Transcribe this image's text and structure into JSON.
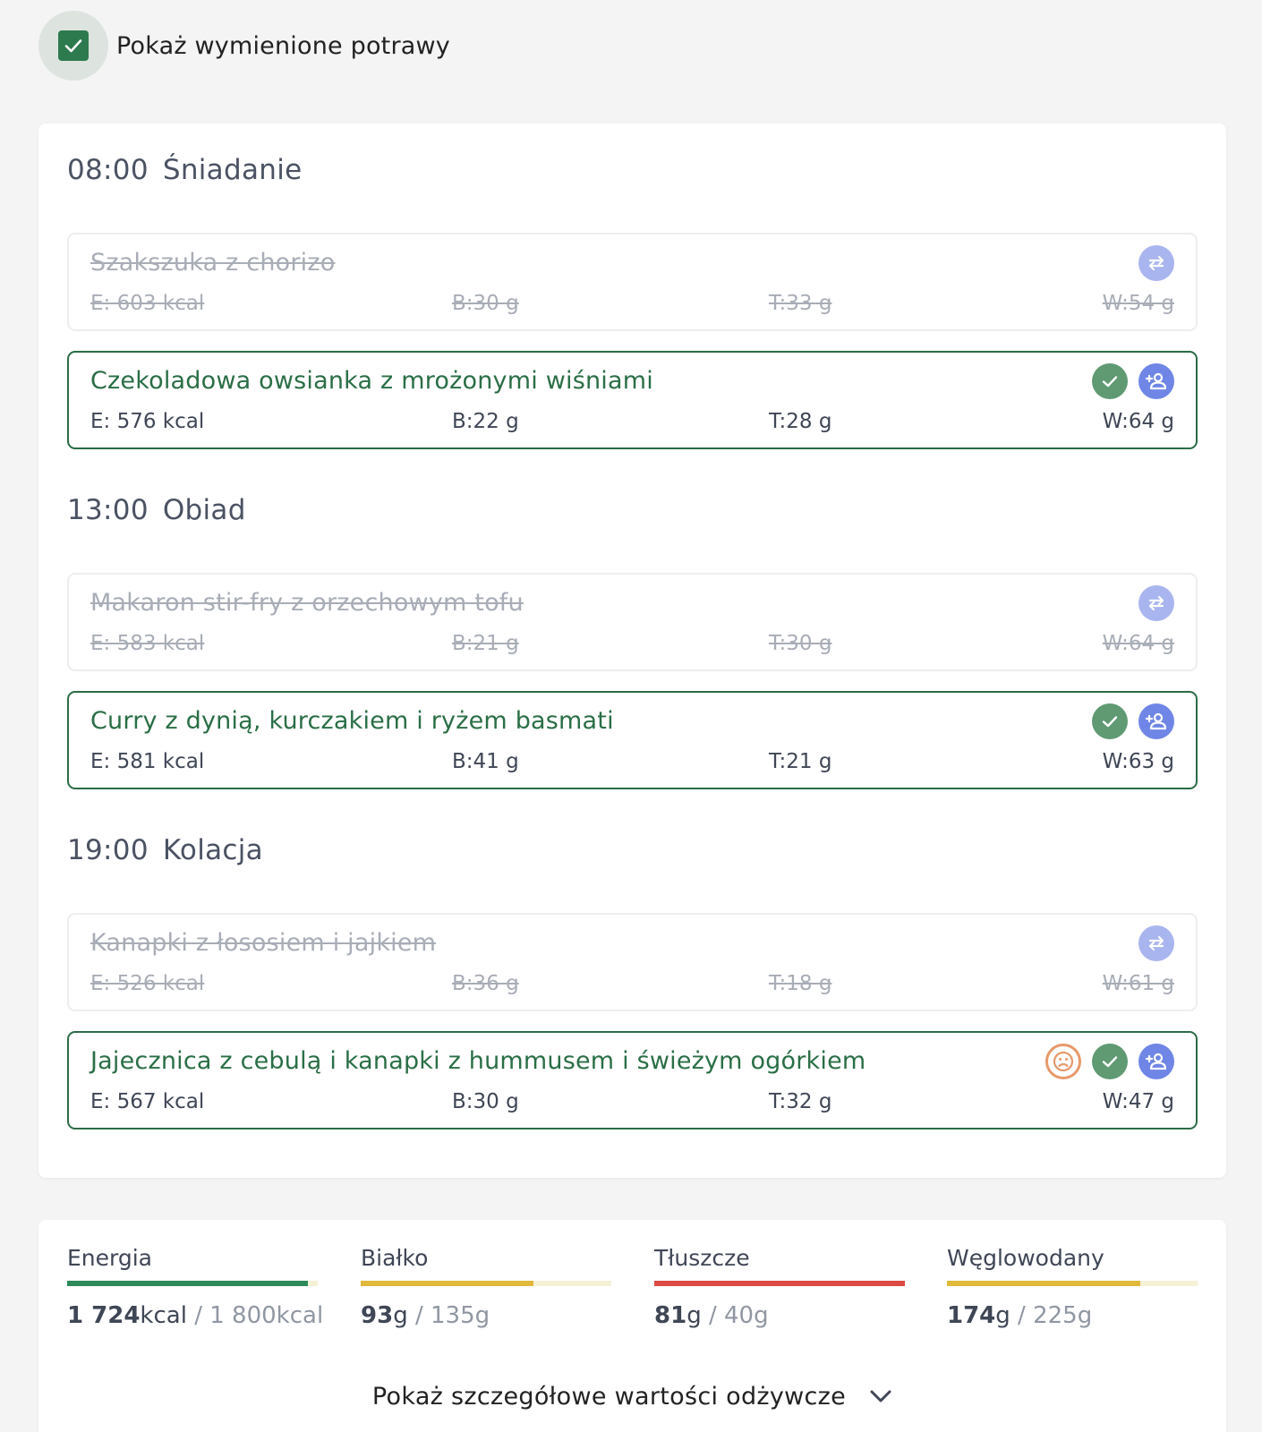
{
  "toggle": {
    "label": "Pokaż wymienione potrawy",
    "checked": true
  },
  "meals": [
    {
      "time": "08:00",
      "name": "Śniadanie",
      "replaced": {
        "name": "Szakszuka z chorizo",
        "e": "E: 603 kcal",
        "b": "B:30 g",
        "t": "T:33 g",
        "w": "W:54 g"
      },
      "current": {
        "name": "Czekoladowa owsianka z mrożonymi wiśniami",
        "e": "E: 576 kcal",
        "b": "B:22 g",
        "t": "T:28 g",
        "w": "W:64 g",
        "icons": [
          "check-icon",
          "add-person-icon"
        ]
      }
    },
    {
      "time": "13:00",
      "name": "Obiad",
      "replaced": {
        "name": "Makaron stir-fry z orzechowym tofu",
        "e": "E: 583 kcal",
        "b": "B:21 g",
        "t": "T:30 g",
        "w": "W:64 g"
      },
      "current": {
        "name": "Curry z dynią, kurczakiem i ryżem basmati",
        "e": "E: 581 kcal",
        "b": "B:41 g",
        "t": "T:21 g",
        "w": "W:63 g",
        "icons": [
          "check-icon",
          "add-person-icon"
        ]
      }
    },
    {
      "time": "19:00",
      "name": "Kolacja",
      "replaced": {
        "name": "Kanapki z łososiem i jajkiem",
        "e": "E: 526 kcal",
        "b": "B:36 g",
        "t": "T:18 g",
        "w": "W:61 g"
      },
      "current": {
        "name": "Jajecznica z cebulą i kanapki z hummusem i świeżym ogórkiem",
        "e": "E: 567 kcal",
        "b": "B:30 g",
        "t": "T:32 g",
        "w": "W:47 g",
        "icons": [
          "sad-face-icon",
          "check-icon",
          "add-person-icon"
        ]
      }
    }
  ],
  "summary": {
    "nutrients": [
      {
        "label": "Energia",
        "current": "1 724",
        "target": "1 800kcal",
        "unit": "kcal",
        "progress": 0.96,
        "color": "#2e8a5a"
      },
      {
        "label": "Białko",
        "current": "93",
        "target": "135g",
        "unit": "g",
        "progress": 0.69,
        "color": "#e0b93a"
      },
      {
        "label": "Tłuszcze",
        "current": "81",
        "target": "40g",
        "unit": "g",
        "progress": 1.0,
        "color": "#dc4a44"
      },
      {
        "label": "Węglowodany",
        "current": "174",
        "target": "225g",
        "unit": "g",
        "progress": 0.77,
        "color": "#e0b93a"
      }
    ],
    "details_label": "Pokaż szczegółowe wartości odżywcze"
  },
  "colors": {
    "accent": "#2d7a4f",
    "swap": "#a9b5ef",
    "person": "#6f86e6",
    "sad": "#e6996a"
  }
}
